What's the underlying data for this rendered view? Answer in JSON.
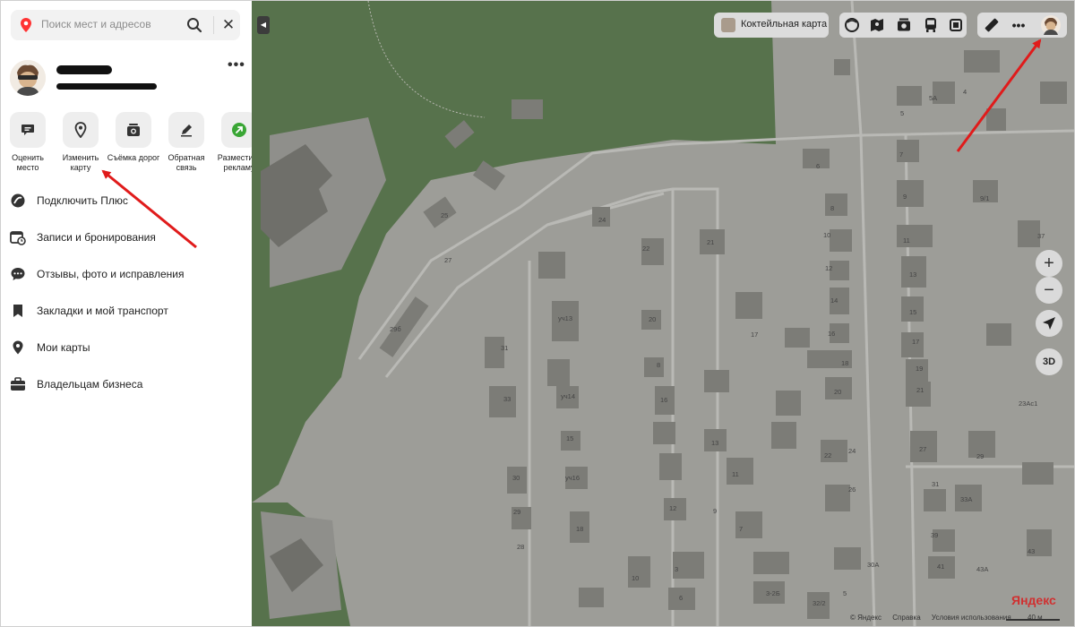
{
  "search": {
    "placeholder": "Поиск мест и адресов"
  },
  "quick_actions": [
    {
      "label": "Оценить место",
      "icon": "rate-place-icon"
    },
    {
      "label": "Изменить карту",
      "icon": "edit-map-icon"
    },
    {
      "label": "Съёмка дорог",
      "icon": "road-camera-icon"
    },
    {
      "label": "Обратная связь",
      "icon": "feedback-pen-icon"
    },
    {
      "label": "Разместить рекламу",
      "icon": "advertise-icon"
    }
  ],
  "menu": [
    {
      "label": "Подключить Плюс",
      "icon": "plus-icon"
    },
    {
      "label": "Записи и бронирования",
      "icon": "calendar-clock-icon"
    },
    {
      "label": "Отзывы, фото и исправления",
      "icon": "chat-bubble-icon"
    },
    {
      "label": "Закладки и мой транспорт",
      "icon": "bookmark-icon"
    },
    {
      "label": "Мои карты",
      "icon": "map-pin-icon"
    },
    {
      "label": "Владельцам бизнеса",
      "icon": "briefcase-icon"
    }
  ],
  "map": {
    "layer_button": "Коктейльная карта",
    "toolbar_icons": [
      "layers-icon",
      "panorama-icon",
      "camera-icon",
      "transport-icon",
      "traffic-icon",
      "ruler-icon",
      "more-icon",
      "profile-avatar"
    ],
    "zoom_in": "+",
    "zoom_out": "−",
    "three_d": "3D",
    "brand": "Яндекс",
    "footer": {
      "copyright": "© Яндекс",
      "help": "Справка",
      "terms": "Условия использования"
    },
    "scale": "40 м",
    "building_labels": [
      "4",
      "5А",
      "5",
      "6",
      "7",
      "8",
      "9",
      "9/1",
      "10",
      "11",
      "12",
      "13",
      "14",
      "15",
      "16",
      "17",
      "18",
      "19",
      "20",
      "21",
      "22",
      "24",
      "25",
      "27",
      "28",
      "29",
      "30",
      "31",
      "33",
      "33А",
      "37",
      "39",
      "41",
      "43",
      "43А",
      "3",
      "6",
      "7",
      "9",
      "10",
      "11",
      "12",
      "13",
      "15",
      "16",
      "17",
      "18",
      "20",
      "21",
      "22",
      "23Ас1",
      "24",
      "26",
      "27",
      "29",
      "30А",
      "31",
      "32/2",
      "3-2Б",
      "5",
      "8",
      "уч13",
      "уч14",
      "уч16",
      "29б",
      "31А"
    ]
  }
}
